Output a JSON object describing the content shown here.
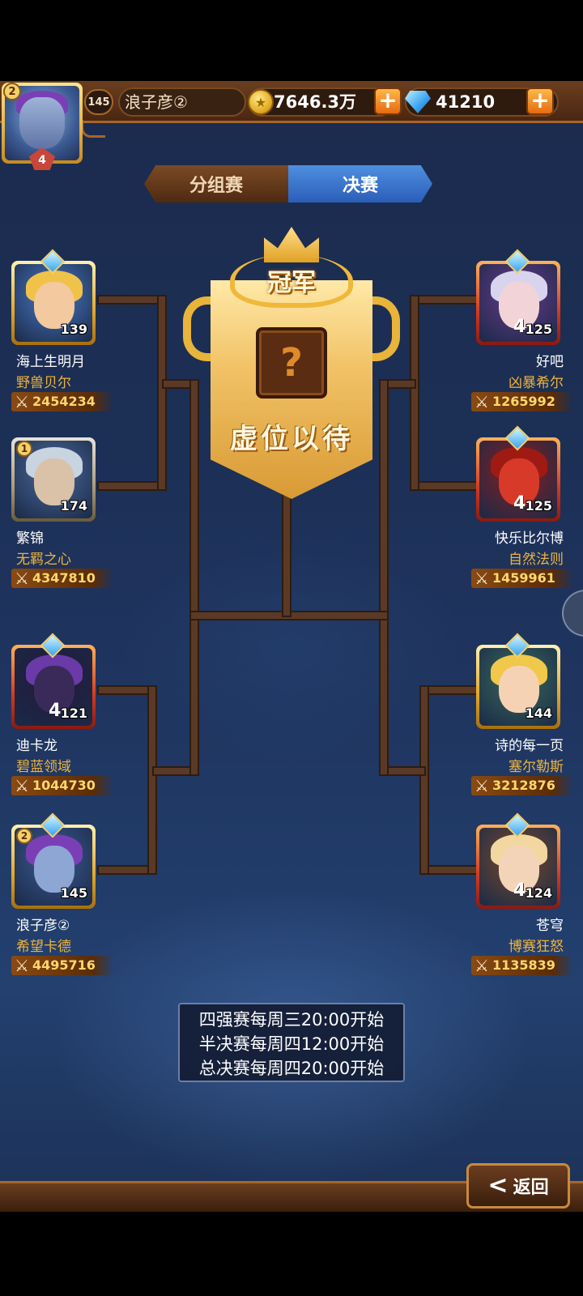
{
  "player_header": {
    "level": "145",
    "name": "浪子彦②",
    "avatar_rank": "2",
    "avatar_stars": "4",
    "gold": "7646.3万",
    "gems": "41210",
    "gold_plus": "+",
    "gems_plus": "+"
  },
  "tabs": [
    {
      "label": "分组赛",
      "active": false
    },
    {
      "label": "决赛",
      "active": true
    }
  ],
  "trophy": {
    "title": "冠军",
    "mystery": "?",
    "status": "虚位以待"
  },
  "bracket": {
    "left": [
      {
        "name": "海上生明月",
        "guild": "野兽贝尔",
        "power": "2454234",
        "level": "139",
        "stars": "",
        "rank": "",
        "frame": "gold",
        "colors": {
          "bg": "#4a7ac8",
          "face": "#f3c9a0",
          "hair": "#f0c24a"
        }
      },
      {
        "name": "繁锦",
        "guild": "无羁之心",
        "power": "4347810",
        "level": "174",
        "stars": "",
        "rank": "1",
        "frame": "silver",
        "colors": {
          "bg": "#4c6a9a",
          "face": "#d9c2a8",
          "hair": "#c8d4e0"
        }
      },
      {
        "name": "迪卡龙",
        "guild": "碧蓝领域",
        "power": "1044730",
        "level": "121",
        "stars": "4",
        "rank": "",
        "frame": "red",
        "colors": {
          "bg": "#241838",
          "face": "#3a2a5a",
          "hair": "#6a3aa8"
        }
      },
      {
        "name": "浪子彦②",
        "guild": "希望卡德",
        "power": "4495716",
        "level": "145",
        "stars": "",
        "rank": "2",
        "frame": "gold",
        "colors": {
          "bg": "#3c5a92",
          "face": "#8ea6d4",
          "hair": "#7a3fb5"
        }
      }
    ],
    "right": [
      {
        "name": "好吧",
        "guild": "凶暴希尔",
        "power": "1265992",
        "level": "125",
        "stars": "4",
        "rank": "",
        "frame": "red",
        "colors": {
          "bg": "#6a3a8a",
          "face": "#f2d4d8",
          "hair": "#d8d4ee"
        }
      },
      {
        "name": "快乐比尔博",
        "guild": "自然法则",
        "power": "1459961",
        "level": "125",
        "stars": "4",
        "rank": "",
        "frame": "red",
        "colors": {
          "bg": "#8a1e1e",
          "face": "#d83a2a",
          "hair": "#a01a14"
        }
      },
      {
        "name": "诗的每一页",
        "guild": "塞尔勒斯",
        "power": "3212876",
        "level": "144",
        "stars": "",
        "rank": "",
        "frame": "gold",
        "colors": {
          "bg": "#3a6a5a",
          "face": "#f6d2b4",
          "hair": "#f0c84a"
        }
      },
      {
        "name": "苍穹",
        "guild": "博赛狂怒",
        "power": "1135839",
        "level": "124",
        "stars": "4",
        "rank": "",
        "frame": "red",
        "colors": {
          "bg": "#7a4a2a",
          "face": "#f4d4b8",
          "hair": "#f2d8a0"
        }
      }
    ]
  },
  "schedule": [
    "四强赛每周三20:00开始",
    "半决赛每周四12:00开始",
    "总决赛每周四20:00开始"
  ],
  "back_button": {
    "label": "返回"
  },
  "icons": {
    "coin": "gold-coin-icon",
    "gem": "diamond-icon",
    "power": "crossed-swords-icon",
    "back": "back-arrow-icon"
  }
}
